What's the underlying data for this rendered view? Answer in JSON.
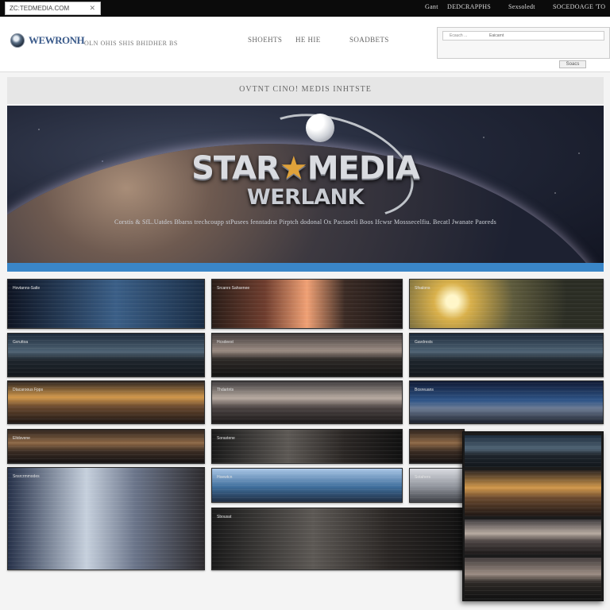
{
  "browser": {
    "url": "ZC:TEDMEDIA.COM",
    "close_icon": "close-icon"
  },
  "top_links": [
    "Gant",
    "DEDCRAPPHS",
    "Sexsoledt",
    "SOCEDOAGE 'TO"
  ],
  "header": {
    "logo_text": "WEWRONH",
    "tagline": "OLN OHIS SHIS BHIDHER BS",
    "nav": [
      "SHOEHTS",
      "HE HIE",
      "SOADBETS"
    ],
    "search_placeholder": "Ecauch ...",
    "search_value": "Eaicarnt",
    "search_button": "Soacs"
  },
  "banner": {
    "title": "OVTNT CINO! MEDIS INHTSTE",
    "logo_line1_a": "STAR",
    "logo_star": "★",
    "logo_line1_b": "MEDIA",
    "logo_line2": "WERLANK",
    "caption": "Corstis & SfL.Uatdes Bbarss trechcoupp stPusees fenntadrst Pirptch dodonal Ox Pactaeeli Boos Ifcwsr Mosssecelfiu. Becatl Jwanate Paoreds"
  },
  "thumbnails": [
    {
      "label": "Hovtanns-Satle"
    },
    {
      "label": "Gvruttoa"
    },
    {
      "label": "Dtacaroous Fpps"
    },
    {
      "label": "Eltdsvene"
    },
    {
      "label": "Snsrcrmmodes"
    },
    {
      "label": "Srcanrs Sahsenee"
    },
    {
      "label": "Hcsdeest"
    },
    {
      "label": "Thdartnts"
    },
    {
      "label": "Sorastene"
    },
    {
      "label": "Hoewtcn"
    },
    {
      "label": "Sbousat"
    },
    {
      "label": "Sfoalons"
    },
    {
      "label": "Gavdrests"
    },
    {
      "label": "Bosreuans"
    },
    {
      "label": "Sotahers"
    }
  ]
}
